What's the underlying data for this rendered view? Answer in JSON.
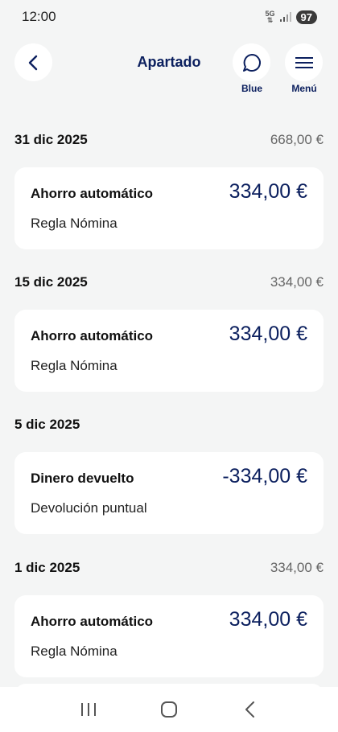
{
  "status_bar": {
    "time": "12:00",
    "network": "5G",
    "battery": "97"
  },
  "header": {
    "title": "Apartado",
    "blue_label": "Blue",
    "menu_label": "Menú"
  },
  "groups": [
    {
      "date": "31 dic 2025",
      "total": "668,00 €",
      "card": {
        "title": "Ahorro automático",
        "subtitle": "Regla Nómina",
        "amount": "334,00 €"
      }
    },
    {
      "date": "15 dic 2025",
      "total": "334,00 €",
      "card": {
        "title": "Ahorro automático",
        "subtitle": "Regla Nómina",
        "amount": "334,00 €"
      }
    },
    {
      "date": "5 dic 2025",
      "total": "",
      "card": {
        "title": "Dinero devuelto",
        "subtitle": "Devolución puntual",
        "amount": "-334,00 €"
      }
    },
    {
      "date": "1 dic 2025",
      "total": "334,00 €",
      "card": {
        "title": "Ahorro automático",
        "subtitle": "Regla Nómina",
        "amount": "334,00 €"
      }
    }
  ],
  "colors": {
    "brand": "#0b1f5e",
    "background": "#f4f5f5",
    "card": "#ffffff"
  },
  "icons": [
    "back-arrow-icon",
    "chat-bubble-icon",
    "hamburger-menu-icon",
    "recent-apps-icon",
    "home-icon",
    "nav-back-icon"
  ]
}
